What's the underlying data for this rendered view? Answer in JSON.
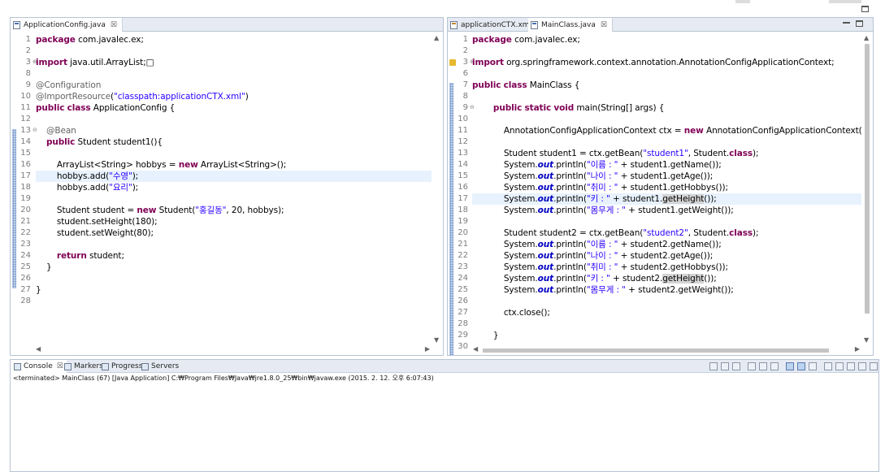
{
  "left_editor": {
    "tabs": [
      {
        "label": "ApplicationConfig.java",
        "close": "☒",
        "active": true
      }
    ],
    "lines": [
      {
        "n": "1",
        "fold": "",
        "segs": [
          [
            "kw",
            "package"
          ],
          [
            "plain",
            " com.javalec.ex;"
          ]
        ]
      },
      {
        "n": "2",
        "fold": "",
        "segs": []
      },
      {
        "n": "3",
        "fold": "⊕",
        "segs": [
          [
            "kw",
            "import"
          ],
          [
            "plain",
            " java.util.ArrayList;"
          ],
          [
            "plain",
            "□"
          ]
        ]
      },
      {
        "n": "8",
        "fold": "",
        "segs": []
      },
      {
        "n": "9",
        "fold": "",
        "segs": [
          [
            "ann",
            "@Configuration"
          ]
        ]
      },
      {
        "n": "10",
        "fold": "",
        "segs": [
          [
            "ann",
            "@"
          ],
          [
            "ann",
            "ImportResource"
          ],
          [
            "plain",
            "("
          ],
          [
            "str",
            "\"classpath:applicationCTX.xml\""
          ],
          [
            "plain",
            ")"
          ]
        ]
      },
      {
        "n": "11",
        "fold": "",
        "segs": [
          [
            "kw",
            "public"
          ],
          [
            "plain",
            " "
          ],
          [
            "kw",
            "class"
          ],
          [
            "plain",
            " ApplicationConfig {"
          ]
        ]
      },
      {
        "n": "12",
        "fold": "",
        "segs": []
      },
      {
        "n": "13",
        "fold": "⊖",
        "segs": [
          [
            "plain",
            "    "
          ],
          [
            "ann",
            "@Bean"
          ]
        ]
      },
      {
        "n": "14",
        "fold": "",
        "segs": [
          [
            "plain",
            "    "
          ],
          [
            "kw",
            "public"
          ],
          [
            "plain",
            " Student student1(){"
          ]
        ]
      },
      {
        "n": "15",
        "fold": "",
        "segs": []
      },
      {
        "n": "16",
        "fold": "",
        "segs": [
          [
            "plain",
            "        ArrayList<String> hobbys = "
          ],
          [
            "kw",
            "new"
          ],
          [
            "plain",
            " ArrayList<String>();"
          ]
        ]
      },
      {
        "n": "17",
        "fold": "",
        "hl": true,
        "segs": [
          [
            "plain",
            "        hobbys.add("
          ],
          [
            "str",
            "\"수영\""
          ],
          [
            "plain",
            ");"
          ]
        ]
      },
      {
        "n": "18",
        "fold": "",
        "segs": [
          [
            "plain",
            "        hobbys.add("
          ],
          [
            "str",
            "\"요리\""
          ],
          [
            "plain",
            ");"
          ]
        ]
      },
      {
        "n": "19",
        "fold": "",
        "segs": []
      },
      {
        "n": "20",
        "fold": "",
        "segs": [
          [
            "plain",
            "        Student student = "
          ],
          [
            "kw",
            "new"
          ],
          [
            "plain",
            " Student("
          ],
          [
            "str",
            "\"홍길동\""
          ],
          [
            "plain",
            ", 20, hobbys);"
          ]
        ]
      },
      {
        "n": "21",
        "fold": "",
        "segs": [
          [
            "plain",
            "        student.setHeight(180);"
          ]
        ]
      },
      {
        "n": "22",
        "fold": "",
        "segs": [
          [
            "plain",
            "        student.setWeight(80);"
          ]
        ]
      },
      {
        "n": "23",
        "fold": "",
        "segs": []
      },
      {
        "n": "24",
        "fold": "",
        "segs": [
          [
            "plain",
            "        "
          ],
          [
            "kw",
            "return"
          ],
          [
            "plain",
            " student;"
          ]
        ]
      },
      {
        "n": "25",
        "fold": "",
        "segs": [
          [
            "plain",
            "    }"
          ]
        ]
      },
      {
        "n": "26",
        "fold": "",
        "segs": []
      },
      {
        "n": "27",
        "fold": "",
        "segs": [
          [
            "plain",
            "}"
          ]
        ]
      },
      {
        "n": "28",
        "fold": "",
        "segs": []
      }
    ]
  },
  "right_editor": {
    "tabs": [
      {
        "label": "applicationCTX.xml",
        "close": "",
        "active": false,
        "icon": "xml"
      },
      {
        "label": "MainClass.java",
        "close": "☒",
        "active": true,
        "icon": "java"
      }
    ],
    "lines": [
      {
        "n": "1",
        "fold": "",
        "segs": [
          [
            "kw",
            "package"
          ],
          [
            "plain",
            " com.javalec.ex;"
          ]
        ]
      },
      {
        "n": "2",
        "fold": "",
        "segs": []
      },
      {
        "n": "3",
        "fold": "⊕",
        "warn": true,
        "segs": [
          [
            "kw",
            "import"
          ],
          [
            "plain",
            " org.springframework.context.annotation.AnnotationConfigApplicationContext;"
          ]
        ]
      },
      {
        "n": "6",
        "fold": "",
        "segs": []
      },
      {
        "n": "7",
        "fold": "",
        "segs": [
          [
            "kw",
            "public"
          ],
          [
            "plain",
            " "
          ],
          [
            "kw",
            "class"
          ],
          [
            "plain",
            " MainClass {"
          ]
        ]
      },
      {
        "n": "8",
        "fold": "",
        "segs": []
      },
      {
        "n": "9",
        "fold": "⊖",
        "segs": [
          [
            "plain",
            "        "
          ],
          [
            "kw",
            "public"
          ],
          [
            "plain",
            " "
          ],
          [
            "kw",
            "static"
          ],
          [
            "plain",
            " "
          ],
          [
            "kw",
            "void"
          ],
          [
            "plain",
            " main(String[] args) {"
          ]
        ]
      },
      {
        "n": "10",
        "fold": "",
        "segs": []
      },
      {
        "n": "11",
        "fold": "",
        "segs": [
          [
            "plain",
            "            AnnotationConfigApplicationContext ctx = "
          ],
          [
            "kw",
            "new"
          ],
          [
            "plain",
            " AnnotationConfigApplicationContext(Ap"
          ]
        ]
      },
      {
        "n": "12",
        "fold": "",
        "segs": []
      },
      {
        "n": "13",
        "fold": "",
        "segs": [
          [
            "plain",
            "            Student student1 = ctx.getBean("
          ],
          [
            "str",
            "\"student1\""
          ],
          [
            "plain",
            ", Student."
          ],
          [
            "kw",
            "class"
          ],
          [
            "plain",
            ");"
          ]
        ]
      },
      {
        "n": "14",
        "fold": "",
        "segs": [
          [
            "plain",
            "            System."
          ],
          [
            "sf",
            "out"
          ],
          [
            "plain",
            ".println("
          ],
          [
            "str",
            "\"이름 : \""
          ],
          [
            "plain",
            " + student1.getName());"
          ]
        ]
      },
      {
        "n": "15",
        "fold": "",
        "segs": [
          [
            "plain",
            "            System."
          ],
          [
            "sf",
            "out"
          ],
          [
            "plain",
            ".println("
          ],
          [
            "str",
            "\"나이 : \""
          ],
          [
            "plain",
            " + student1.getAge());"
          ]
        ]
      },
      {
        "n": "16",
        "fold": "",
        "segs": [
          [
            "plain",
            "            System."
          ],
          [
            "sf",
            "out"
          ],
          [
            "plain",
            ".println("
          ],
          [
            "str",
            "\"취미 : \""
          ],
          [
            "plain",
            " + student1.getHobbys());"
          ]
        ]
      },
      {
        "n": "17",
        "fold": "",
        "hl": true,
        "segs": [
          [
            "plain",
            "            System."
          ],
          [
            "sf",
            "out"
          ],
          [
            "plain",
            ".println("
          ],
          [
            "str",
            "\"키 : \""
          ],
          [
            "plain",
            " + student1."
          ],
          [
            "occ",
            "getHeight"
          ],
          [
            "plain",
            "());"
          ]
        ]
      },
      {
        "n": "18",
        "fold": "",
        "segs": [
          [
            "plain",
            "            System."
          ],
          [
            "sf",
            "out"
          ],
          [
            "plain",
            ".println("
          ],
          [
            "str",
            "\"몸무게 : \""
          ],
          [
            "plain",
            " + student1.getWeight());"
          ]
        ]
      },
      {
        "n": "19",
        "fold": "",
        "segs": []
      },
      {
        "n": "20",
        "fold": "",
        "segs": [
          [
            "plain",
            "            Student student2 = ctx.getBean("
          ],
          [
            "str",
            "\"student2\""
          ],
          [
            "plain",
            ", Student."
          ],
          [
            "kw",
            "class"
          ],
          [
            "plain",
            ");"
          ]
        ]
      },
      {
        "n": "21",
        "fold": "",
        "segs": [
          [
            "plain",
            "            System."
          ],
          [
            "sf",
            "out"
          ],
          [
            "plain",
            ".println("
          ],
          [
            "str",
            "\"이름 : \""
          ],
          [
            "plain",
            " + student2.getName());"
          ]
        ]
      },
      {
        "n": "22",
        "fold": "",
        "segs": [
          [
            "plain",
            "            System."
          ],
          [
            "sf",
            "out"
          ],
          [
            "plain",
            ".println("
          ],
          [
            "str",
            "\"나이 : \""
          ],
          [
            "plain",
            " + student2.getAge());"
          ]
        ]
      },
      {
        "n": "23",
        "fold": "",
        "segs": [
          [
            "plain",
            "            System."
          ],
          [
            "sf",
            "out"
          ],
          [
            "plain",
            ".println("
          ],
          [
            "str",
            "\"취미 : \""
          ],
          [
            "plain",
            " + student2.getHobbys());"
          ]
        ]
      },
      {
        "n": "24",
        "fold": "",
        "segs": [
          [
            "plain",
            "            System."
          ],
          [
            "sf",
            "out"
          ],
          [
            "plain",
            ".println("
          ],
          [
            "str",
            "\"키 : \""
          ],
          [
            "plain",
            " + student2."
          ],
          [
            "occ",
            "getHeight"
          ],
          [
            "plain",
            "());"
          ]
        ]
      },
      {
        "n": "25",
        "fold": "",
        "segs": [
          [
            "plain",
            "            System."
          ],
          [
            "sf",
            "out"
          ],
          [
            "plain",
            ".println("
          ],
          [
            "str",
            "\"몸무게 : \""
          ],
          [
            "plain",
            " + student2.getWeight());"
          ]
        ]
      },
      {
        "n": "26",
        "fold": "",
        "segs": []
      },
      {
        "n": "27",
        "fold": "",
        "segs": [
          [
            "plain",
            "            ctx.close();"
          ]
        ]
      },
      {
        "n": "28",
        "fold": "",
        "segs": []
      },
      {
        "n": "29",
        "fold": "",
        "segs": [
          [
            "plain",
            "        }"
          ]
        ]
      },
      {
        "n": "30",
        "fold": "",
        "segs": []
      }
    ]
  },
  "console": {
    "tabs": [
      {
        "label": "Console",
        "close": "☒",
        "active": true,
        "icon": "console-icon"
      },
      {
        "label": "Markers",
        "close": "",
        "active": false,
        "icon": "markers-icon"
      },
      {
        "label": "Progress",
        "close": "",
        "active": false,
        "icon": "progress-icon"
      },
      {
        "label": "Servers",
        "close": "",
        "active": false,
        "icon": "servers-icon"
      }
    ],
    "status": "<terminated> MainClass (67) [Java Application] C:₩Program Files₩Java₩jre1.8.0_25₩bin₩javaw.exe (2015. 2. 12. 오후 6:07:43)",
    "toolbar": [
      "terminate-icon",
      "remove-launch-icon",
      "remove-all-icon",
      "clear-console-icon",
      "scroll-lock-icon",
      "word-wrap-icon",
      "show-on-output-icon",
      "show-on-error-icon",
      "pin-console-icon",
      "display-console-icon",
      "open-console-icon",
      "view-menu-icon",
      "minimize-icon",
      "maximize-icon"
    ]
  },
  "colors": {
    "keyword": "#7f0055",
    "string": "#2a00ff",
    "annotation": "#646464",
    "static_field": "#0000c0",
    "current_line": "#e8f2fe"
  }
}
